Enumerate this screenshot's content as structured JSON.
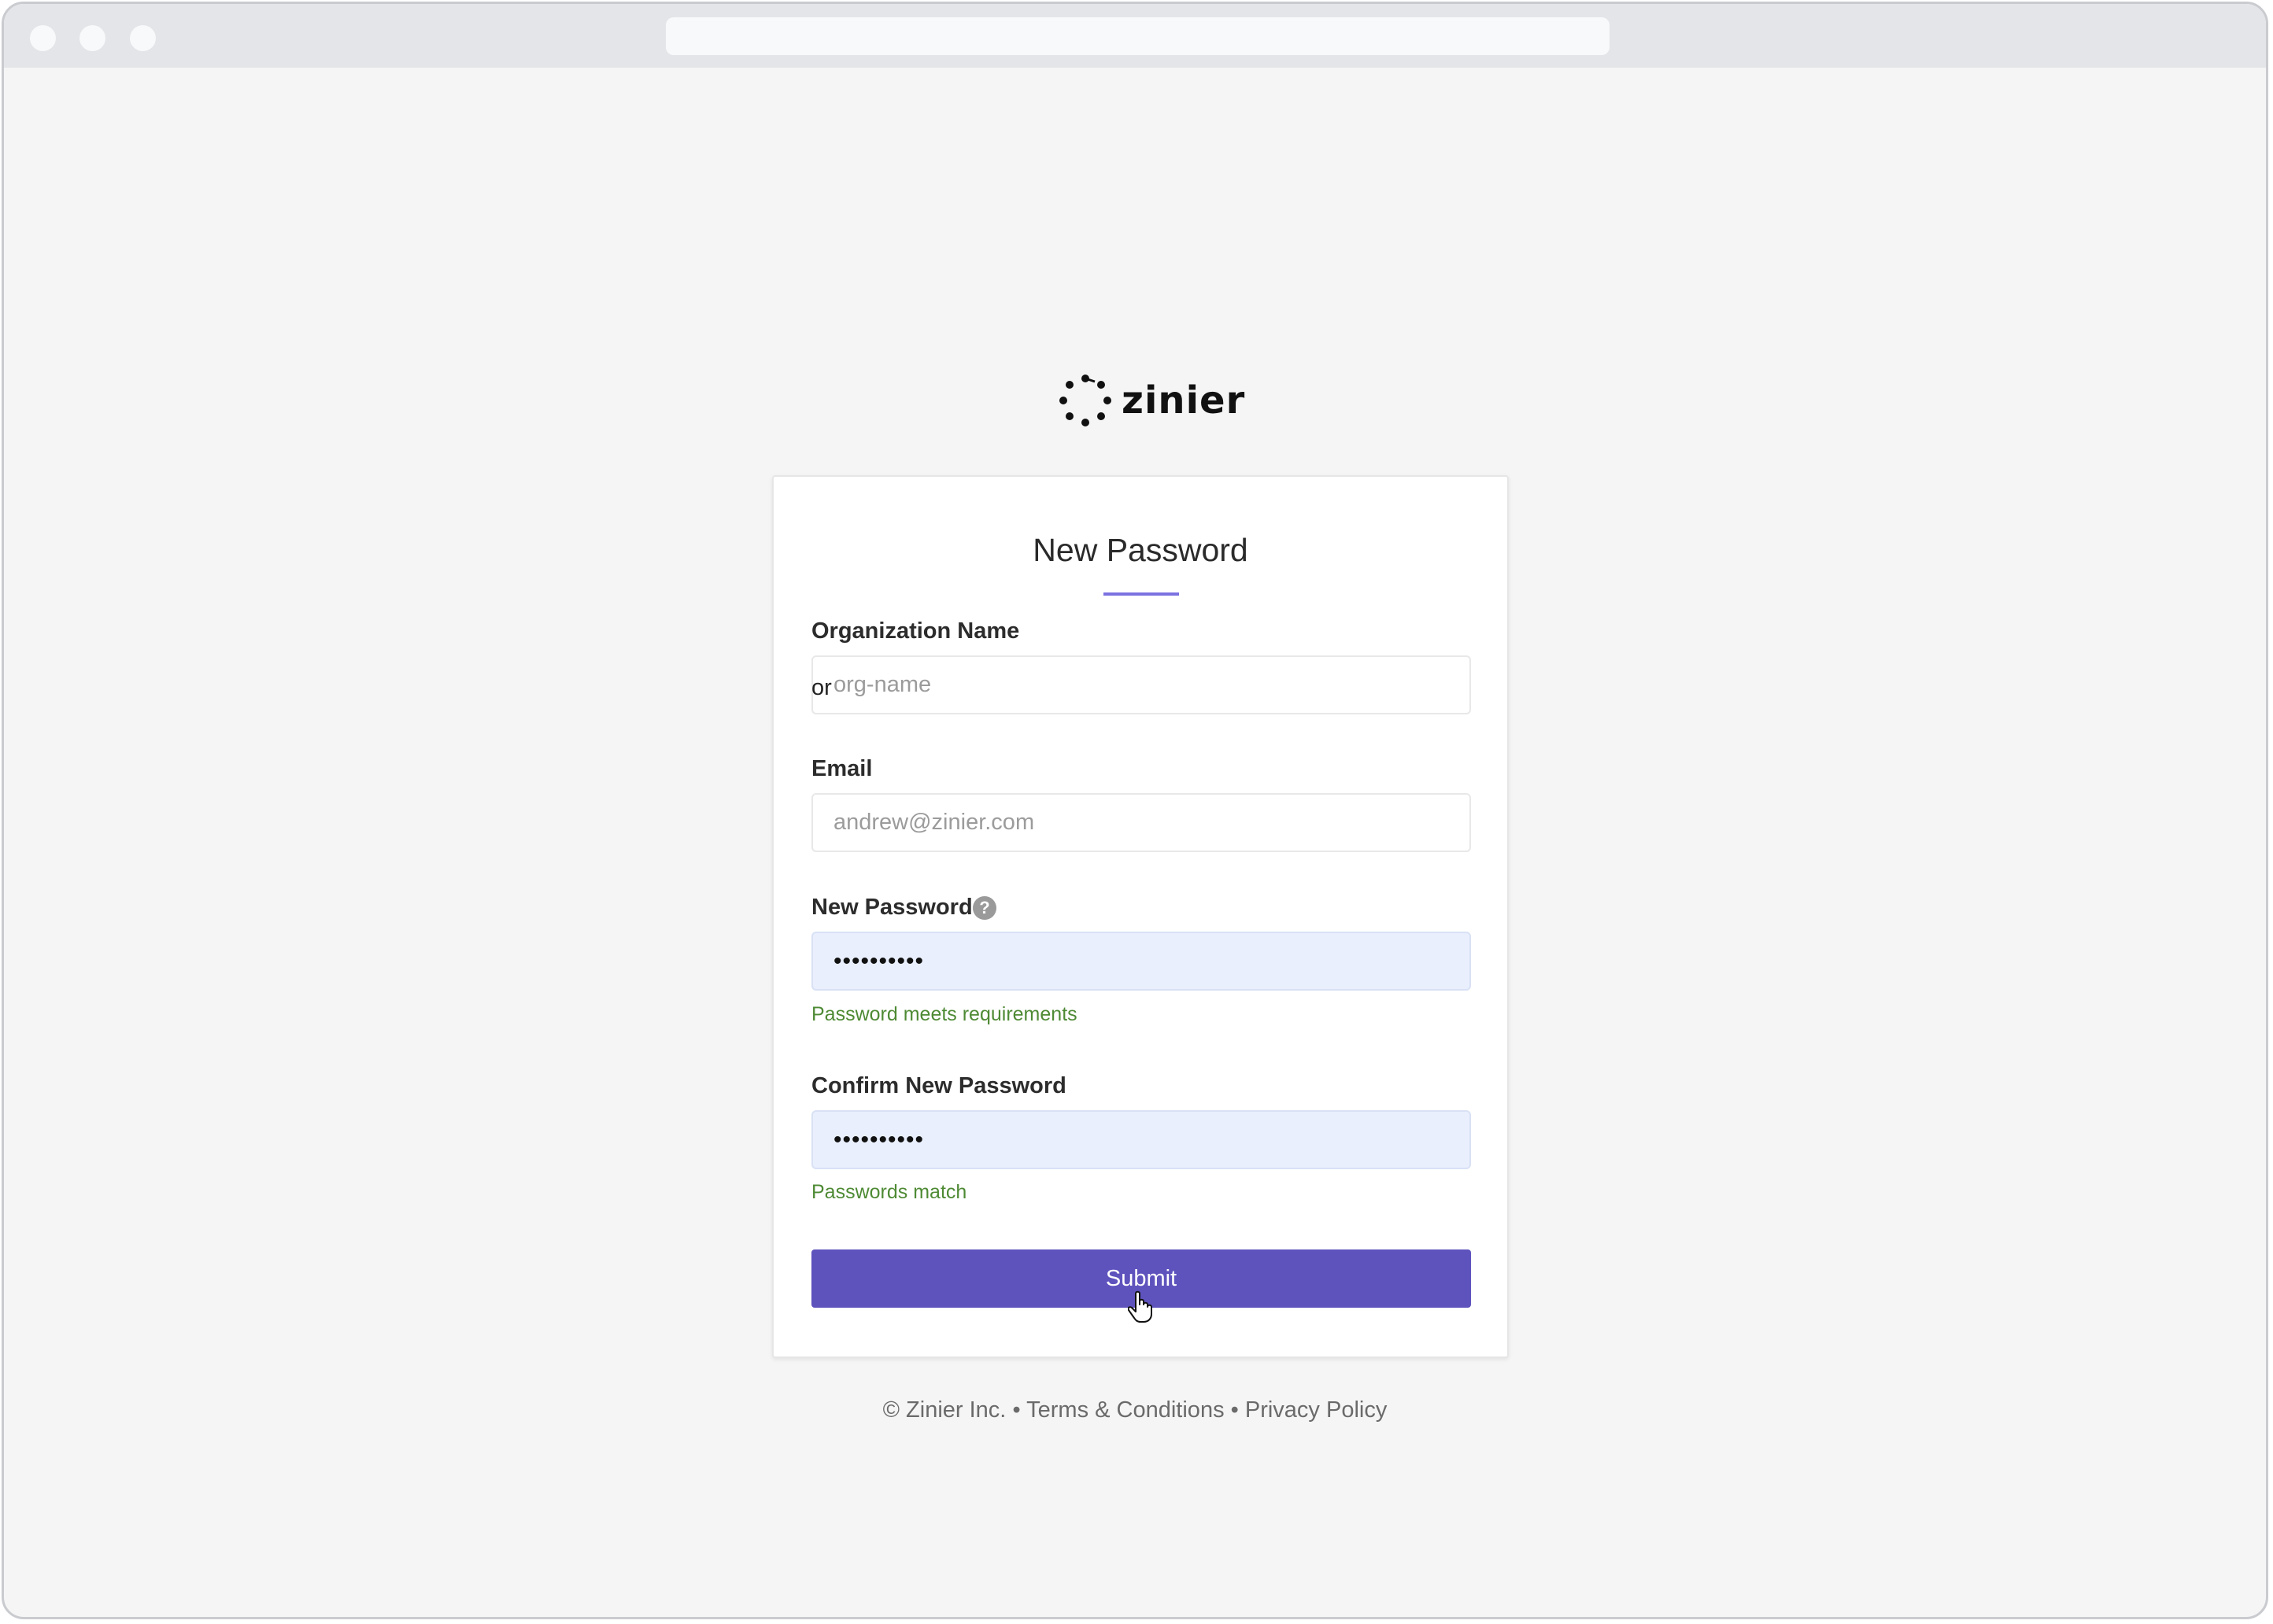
{
  "brand": {
    "name": "zinier",
    "accent_color": "#5e53bd",
    "underline_color": "#7b71e0",
    "success_color": "#4e8a34"
  },
  "form": {
    "title": "New Password",
    "org": {
      "label": "Organization Name",
      "placeholder": "org-name",
      "typed_value": "or"
    },
    "email": {
      "label": "Email",
      "placeholder": "andrew@zinier.com"
    },
    "new_password": {
      "label": "New Password",
      "value": "••••••••••",
      "help_icon": "question-circle-icon",
      "hint": "Password meets requirements"
    },
    "confirm_password": {
      "label": "Confirm New Password",
      "value": "••••••••••",
      "hint": "Passwords match"
    },
    "submit_label": "Submit"
  },
  "footer": {
    "copyright": "© Zinier Inc.",
    "separator": "•",
    "terms": "Terms & Conditions",
    "privacy": "Privacy Policy"
  }
}
